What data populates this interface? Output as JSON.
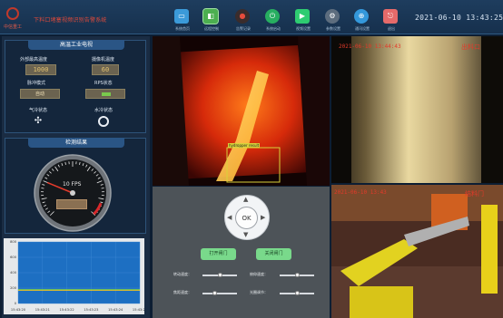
{
  "header": {
    "title": "下料口堵塞视频识别告警系统",
    "logo_text": "中信重工",
    "clock": "2021-06-10 13:43:25",
    "toolbar": [
      {
        "label": "系统首页",
        "icon": "monitor-icon",
        "color": "#3b9ad9"
      },
      {
        "label": "远程控制",
        "icon": "control-icon",
        "color": "#4caf50"
      },
      {
        "label": "告警记录",
        "icon": "alarm-icon",
        "color": "#e74c3c"
      },
      {
        "label": "系统启动",
        "icon": "power-icon",
        "color": "#27ae60"
      },
      {
        "label": "视频设置",
        "icon": "video-icon",
        "color": "#2ecc71"
      },
      {
        "label": "参数设置",
        "icon": "gear-icon",
        "color": "#7f8c8d"
      },
      {
        "label": "通讯设置",
        "icon": "network-icon",
        "color": "#3498db"
      },
      {
        "label": "退出",
        "icon": "exit-icon",
        "color": "#e66a6a"
      }
    ]
  },
  "left": {
    "tv_section": {
      "title": "高温工业电视",
      "outer_temp_label": "外部最高温度",
      "outer_temp_value": "1000",
      "cam_temp_label": "摄像机温度",
      "cam_temp_value": "60",
      "mode_label": "脉冲模式",
      "mode_value": "自动",
      "rps_label": "RPS状态",
      "air_label": "气冷状态",
      "water_label": "水冷状态"
    },
    "detect_section": {
      "title": "检测结果",
      "fps_text": "10 FPS",
      "fps_value": 10
    }
  },
  "chart_data": {
    "type": "line",
    "x": [
      "15:43:20",
      "15:43:21",
      "15:43:22",
      "15:43:23",
      "15:43:24",
      "15:43:25"
    ],
    "ylim": [
      0,
      800
    ],
    "yticks": [
      "800",
      "600",
      "400",
      "200",
      "0"
    ],
    "series": [
      {
        "values": [
          180,
          180,
          180,
          180,
          180,
          180
        ],
        "color": "#7fd640"
      },
      {
        "values": [
          170,
          170,
          170,
          170,
          170,
          170
        ],
        "color": "#f0c020"
      }
    ],
    "grid": true,
    "background": "#1d6fc2"
  },
  "center": {
    "detection_label": "hydropper result",
    "buttons": {
      "open": "打开闸门",
      "close": "关闭闸门"
    },
    "ok_label": "OK",
    "sliders": [
      {
        "label": "转动速度：",
        "value": 0.5
      },
      {
        "label": "俯仰速度：",
        "value": 0.5
      },
      {
        "label": "焦距速度：",
        "value": 0.35
      },
      {
        "label": "光圈调节：",
        "value": 0.5
      }
    ]
  },
  "right": {
    "cam1_timestamp": "2021-06-10 13:44:43",
    "cam1_label": "出料口",
    "cam2_timestamp": "2021-06-10 13:43",
    "cam2_label": "结料门"
  },
  "colors": {
    "alarm_text": "#e23a2a",
    "panel_bg": "#1a2c43",
    "header_bg": "#1e3d5e"
  }
}
